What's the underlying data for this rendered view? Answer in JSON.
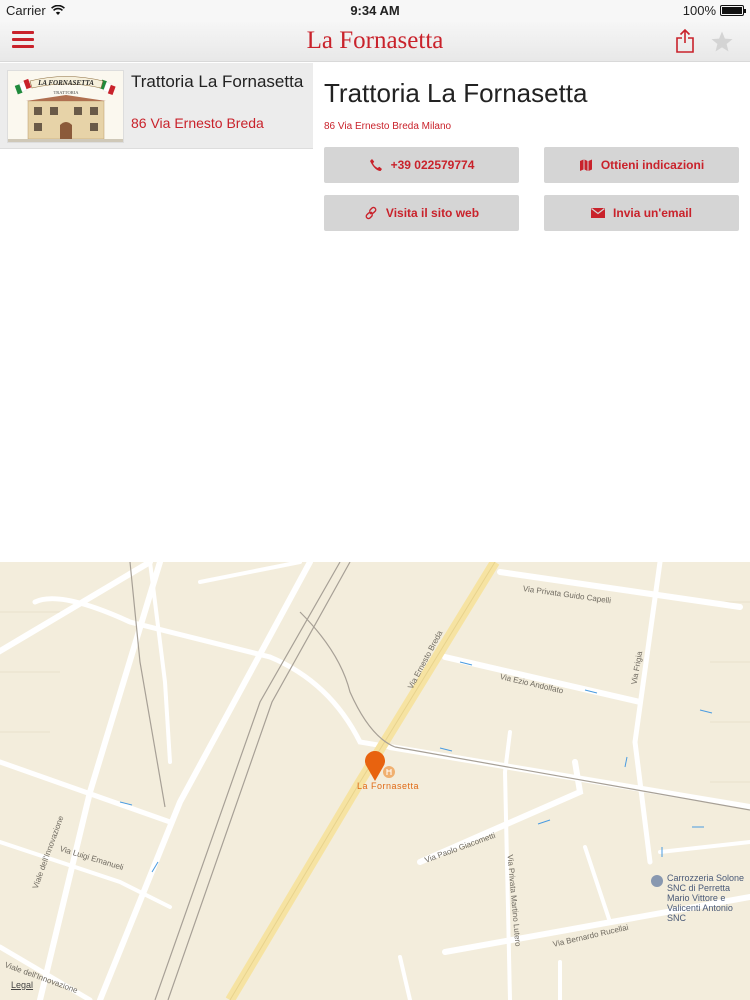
{
  "status_bar": {
    "carrier": "Carrier",
    "time": "9:34 AM",
    "battery": "100%"
  },
  "nav": {
    "title": "La Fornasetta",
    "menu_icon": "hamburger-icon",
    "share_icon": "share-icon",
    "favorite_icon": "star-icon"
  },
  "list": {
    "items": [
      {
        "name": "Trattoria La Fornasetta",
        "address": "86 Via Ernesto Breda",
        "thumb_sign": "LA FORNASETTA",
        "thumb_sub": "TRATTORIA"
      }
    ]
  },
  "detail": {
    "title": "Trattoria La Fornasetta",
    "address": "86 Via Ernesto Breda Milano",
    "buttons": {
      "phone": "+39 022579774",
      "directions": "Ottieni indicazioni",
      "website": "Visita il sito web",
      "email": "Invia un'email"
    }
  },
  "map": {
    "poi_label": "La Fornasetta",
    "poi2_label": "Carrozzeria Solone SNC di Perretta Mario Vittore e Valicenti Antonio SNC",
    "legal": "Legal",
    "streets": {
      "guido_capelli": "Via Privata Guido Capelli",
      "ernesto_breda": "Via Ernesto Breda",
      "ezio_andolfato": "Via Ezio Andolfato",
      "frigia": "Via Frigia",
      "innovazione1": "Viale dell'Innovazione",
      "luigi_emanueli": "Via Luigi Emanueli",
      "paolo_giacometti": "Via Paolo Giacometti",
      "martino_lutero": "Via Privata Martino Lutero",
      "bernardo_rucellai": "Via Bernardo Rucellai",
      "innovazione2": "Viale dell'Innovazione"
    }
  },
  "colors": {
    "accent": "#c9222b",
    "map_bg": "#f3eddc",
    "pin": "#e8630f"
  }
}
